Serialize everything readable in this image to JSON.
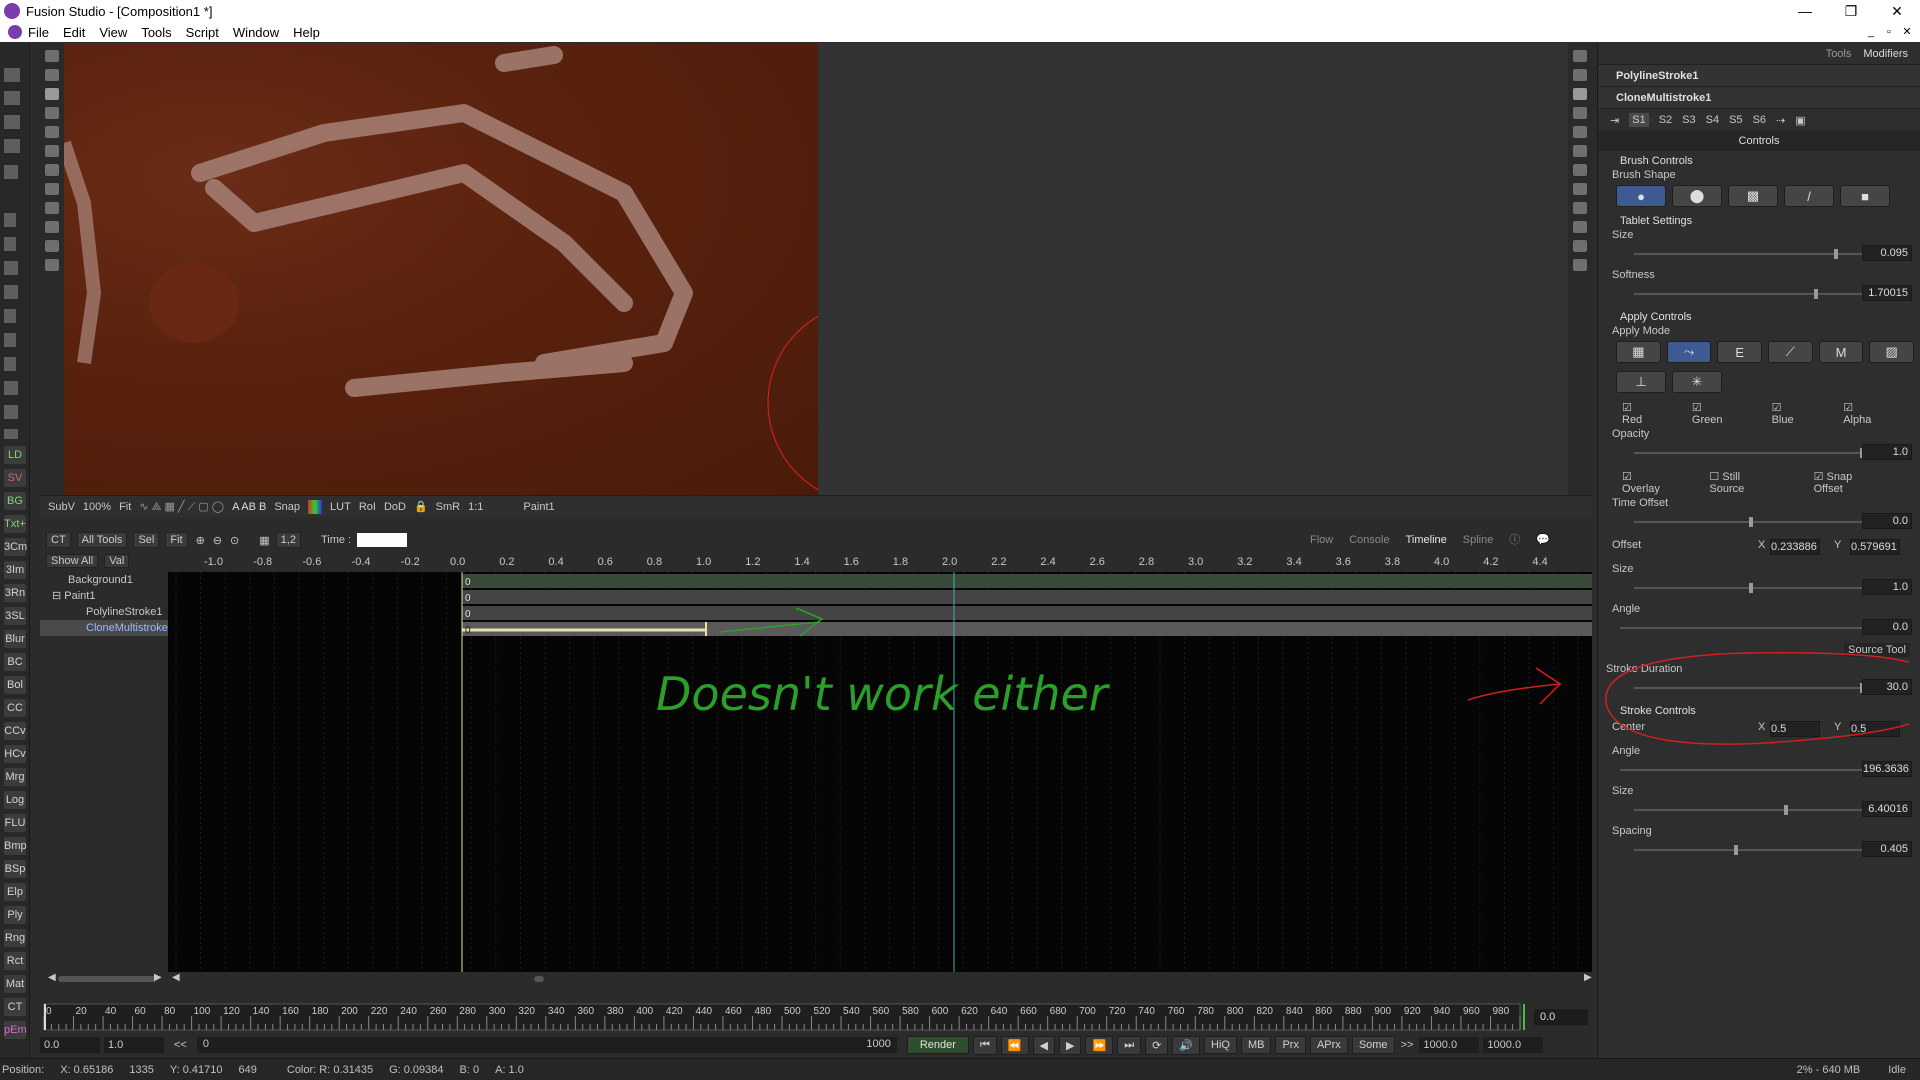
{
  "window": {
    "title": "Fusion Studio - [Composition1 *]",
    "controls": [
      "—",
      "❐",
      "✕"
    ]
  },
  "menu": {
    "items": [
      "File",
      "Edit",
      "View",
      "Tools",
      "Script",
      "Window",
      "Help"
    ],
    "mdi": [
      "_",
      "▫",
      "✕"
    ]
  },
  "left_toolbar": {
    "tools": [
      "LD",
      "SV",
      "BG",
      "Txt+",
      "3Cm",
      "3Im",
      "3Rn",
      "3SL",
      "Blur",
      "BC",
      "Bol",
      "CC",
      "CCv",
      "HCv",
      "Mrg",
      "Log",
      "FLU",
      "Bmp",
      "BSp",
      "Elp",
      "Ply",
      "Rng",
      "Rct",
      "Mat",
      "CT",
      "pEm"
    ]
  },
  "viewer_bar": {
    "subv": "SubV",
    "zoom": "100%",
    "fit": "Fit",
    "snap": "Snap",
    "lut": "LUT",
    "roi": "RoI",
    "dod": "DoD",
    "smr": "SmR",
    "one_to_one": "1:1",
    "node": "Paint1"
  },
  "timeline_bar": {
    "ct": "CT",
    "all_tools": "All Tools",
    "sel": "Sel",
    "fit": "Fit",
    "ratio": "1,2",
    "time_label": "Time :",
    "show_all": "Show All",
    "val": "Val"
  },
  "bottom_tabs": [
    "Flow",
    "Console",
    "Timeline",
    "Spline"
  ],
  "ruler": [
    "-1.0",
    "-0.8",
    "-0.6",
    "-0.4",
    "-0.2",
    "0.0",
    "0.2",
    "0.4",
    "0.6",
    "0.8",
    "1.0",
    "1.2",
    "1.4",
    "1.6",
    "1.8",
    "2.0",
    "2.2",
    "2.4",
    "2.6",
    "2.8",
    "3.0",
    "3.2",
    "3.4",
    "3.6",
    "3.8",
    "4.0",
    "4.2",
    "4.4"
  ],
  "tree": {
    "background": "Background1",
    "paint": "Paint1",
    "polyline": "PolylineStroke1",
    "clone": "CloneMultistroke"
  },
  "track_markers": [
    "0",
    "0",
    "0",
    "0"
  ],
  "annotation_text": "Doesn't work either",
  "frames": [
    "0",
    "20",
    "40",
    "60",
    "80",
    "100",
    "120",
    "140",
    "160",
    "180",
    "200",
    "220",
    "240",
    "260",
    "280",
    "300",
    "320",
    "340",
    "360",
    "380",
    "400",
    "420",
    "440",
    "460",
    "480",
    "500",
    "520",
    "540",
    "560",
    "580",
    "600",
    "620",
    "640",
    "660",
    "680",
    "700",
    "720",
    "740",
    "760",
    "780",
    "800",
    "820",
    "840",
    "860",
    "880",
    "900",
    "920",
    "940",
    "960",
    "980"
  ],
  "transport": {
    "start": "0.0",
    "step": "1.0",
    "back": "<<",
    "range_start": "0",
    "range_end": "1000",
    "render": "Render",
    "hiq": "HiQ",
    "mb": "MB",
    "prx": "Prx",
    "aprx": "APrx",
    "some": "Some",
    "fwd": ">>",
    "end1": "1000.0",
    "end2": "1000.0",
    "current": "0.0"
  },
  "status": {
    "position": "Position:",
    "x": "X: 0.65186",
    "xp": "1335",
    "y": "Y: 0.41710",
    "yp": "649",
    "color_r": "Color: R: 0.31435",
    "g": "G: 0.09384",
    "b": "B: 0",
    "a": "A: 1.0",
    "mem": "2% - 640 MB",
    "state": "Idle"
  },
  "inspector": {
    "tab_tools": "Tools",
    "tab_modifiers": "Modifiers",
    "tool1": "PolylineStroke1",
    "tool2": "CloneMultistroke1",
    "strokes": [
      "S1",
      "S2",
      "S3",
      "S4",
      "S5",
      "S6"
    ],
    "controls_label": "Controls",
    "brush_controls": "Brush Controls",
    "brush_shape": "Brush Shape",
    "tablet": "Tablet Settings",
    "size_label": "Size",
    "size_val": "0.095",
    "softness_label": "Softness",
    "softness_val": "1.70015",
    "apply_controls": "Apply Controls",
    "apply_mode": "Apply Mode",
    "red": "Red",
    "green": "Green",
    "blue": "Blue",
    "alpha": "Alpha",
    "opacity_label": "Opacity",
    "opacity_val": "1.0",
    "overlay": "Overlay",
    "still_source": "Still Source",
    "snap_offset": "Snap Offset",
    "time_offset_label": "Time Offset",
    "time_offset_val": "0.0",
    "offset_label": "Offset",
    "x_label": "X",
    "offset_x": "0.233886",
    "y_label": "Y",
    "offset_y": "0.579691",
    "size2_label": "Size",
    "size2_val": "1.0",
    "angle_label": "Angle",
    "angle_val": "0.0",
    "source_tool": "Source Tool",
    "stroke_duration_label": "Stroke Duration",
    "stroke_duration_val": "30.0",
    "stroke_controls": "Stroke Controls",
    "center_label": "Center",
    "center_x": "0.5",
    "center_y": "0.5",
    "angle2_label": "Angle",
    "angle2_val": "196.3636",
    "size3_label": "Size",
    "size3_val": "6.40016",
    "spacing_label": "Spacing",
    "spacing_val": "0.405"
  }
}
